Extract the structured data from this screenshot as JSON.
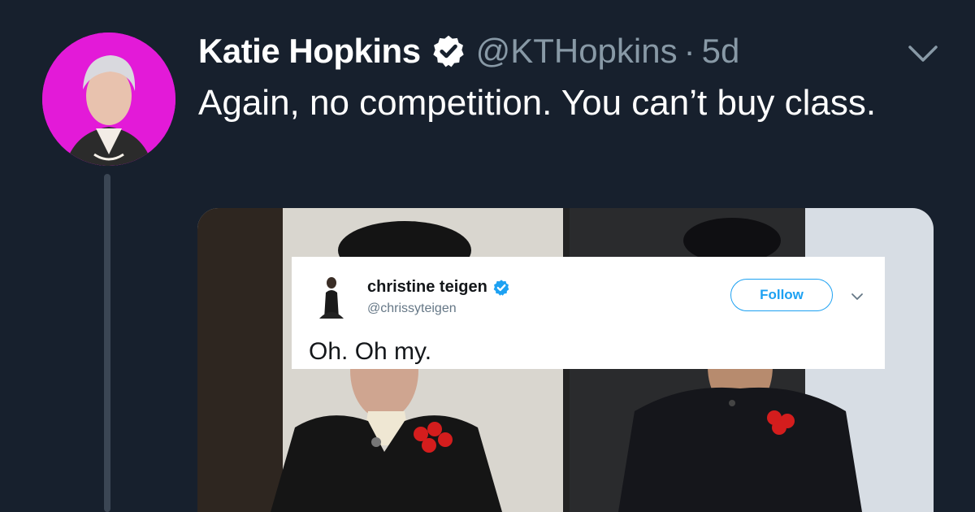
{
  "tweet": {
    "display_name": "Katie Hopkins",
    "handle": "@KTHopkins",
    "separator": "·",
    "time": "5d",
    "text": "Again, no competition. You can’t buy class.",
    "avatar_color": "#e31ad8",
    "icons": [
      "verified-badge-icon",
      "chevron-down-icon"
    ]
  },
  "embed": {
    "display_name": "christine teigen",
    "handle": "@chrissyteigen",
    "follow_label": "Follow",
    "text": "Oh. Oh my.",
    "accent_color": "#1da1f2",
    "icons": [
      "verified-badge-icon",
      "chevron-down-icon"
    ]
  },
  "theme": {
    "background": "#17202d",
    "name_color": "#ffffff",
    "muted_color": "#8899a6"
  }
}
